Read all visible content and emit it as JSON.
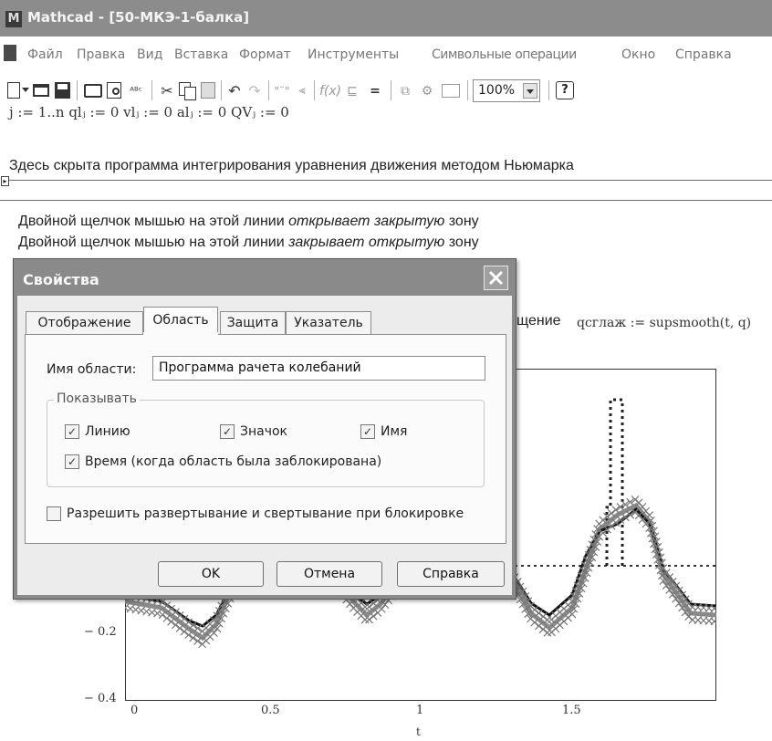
{
  "window": {
    "title": "Mathcad - [50-МКЭ-1-балка]",
    "app_icon": "mathcad-icon"
  },
  "menu": {
    "doc_icon": "document-icon",
    "items": [
      "Файл",
      "Правка",
      "Вид",
      "Вставка",
      "Формат",
      "Инструменты",
      "Символьные операции",
      "Окно",
      "Справка"
    ]
  },
  "toolbar": {
    "icons": [
      "new-file-icon",
      "open-icon",
      "save-icon",
      "print-icon",
      "print-preview-icon",
      "spellcheck-icon",
      "cut-icon",
      "copy-icon",
      "paste-icon",
      "undo-icon",
      "redo-icon",
      "align-icon",
      "align-down-icon",
      "insert-function-icon",
      "insert-unit-icon",
      "calculate-icon",
      "resource-icon",
      "component-icon",
      "text-region-icon",
      "help-icon"
    ],
    "zoom": "100%"
  },
  "worksheet": {
    "definitions": "j := 1..n    qlⱼ := 0    vlⱼ := 0    alⱼ := 0    QVⱼ := 0",
    "hidden_note": "Здесь скрыта программа интегрирования уравнения движения методом Ньюмарка",
    "area_marker": "▸",
    "line1_prefix": "Двойной щелчок мышью на этой линии ",
    "line1_italic": "открывает закрытую",
    "line1_suffix": " зону",
    "line2_prefix": "Двойной щелчок мышью на этой линии ",
    "line2_italic": "закрывает открытую",
    "line2_suffix": " зону",
    "partial_text": "щение",
    "smooth_def": "qсглаж := supsmooth(t, q)"
  },
  "chart_data": {
    "type": "line",
    "xlabel": "t",
    "ylabel": "",
    "xlim": [
      0,
      2.0
    ],
    "ylim": [
      -0.4,
      0.5
    ],
    "x_ticks": [
      "0",
      "0.5",
      "1",
      "1.5"
    ],
    "y_ticks": [
      "− 0.2",
      "− 0.4"
    ],
    "series": [
      {
        "style": "cross-markers",
        "color": "#8a8a8a"
      },
      {
        "style": "thick-line",
        "color": "#111111"
      },
      {
        "style": "dotted",
        "color": "#222222"
      }
    ]
  },
  "dialog": {
    "title": "Свойства",
    "close_icon": "close-icon",
    "tabs": [
      "Отображение",
      "Область",
      "Защита",
      "Указатель"
    ],
    "active_tab": "Область",
    "area_name_label": "Имя области:",
    "area_name_value": "Программа рачета колебаний",
    "show_group_label": "Показывать",
    "checks": {
      "line": "Линию",
      "icon": "Значок",
      "name": "Имя",
      "time": "Время (когда область была заблокирована)",
      "allow": "Разрешить развертывание и свертывание при блокировке"
    },
    "buttons": {
      "ok": "OK",
      "cancel": "Отмена",
      "help": "Справка"
    }
  }
}
